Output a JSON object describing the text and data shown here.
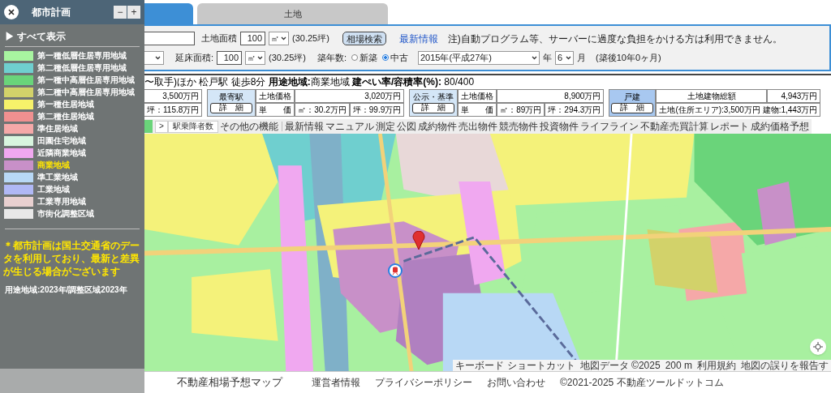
{
  "zoning_panel": {
    "title": "都市計画",
    "minus": "−",
    "plus": "+",
    "show_all": "▶ すべて表示",
    "legend": [
      {
        "label": "第一種低層住居専用地域",
        "color": "#a8f5a0",
        "selected": false
      },
      {
        "label": "第二種低層住居専用地域",
        "color": "#6fcfcf",
        "selected": false
      },
      {
        "label": "第一種中高層住居専用地域",
        "color": "#6ad47a",
        "selected": false
      },
      {
        "label": "第二種中高層住居専用地域",
        "color": "#d2d26a",
        "selected": false
      },
      {
        "label": "第一種住居地域",
        "color": "#f7f26a",
        "selected": false
      },
      {
        "label": "第二種住居地域",
        "color": "#f09090",
        "selected": false
      },
      {
        "label": "準住居地域",
        "color": "#f5a8a8",
        "selected": false
      },
      {
        "label": "田園住宅地域",
        "color": "#d8f5df",
        "selected": false
      },
      {
        "label": "近隣商業地域",
        "color": "#f0a8f0",
        "selected": false
      },
      {
        "label": "商業地域",
        "color": "#c890c8",
        "selected": true
      },
      {
        "label": "準工業地域",
        "color": "#b8d8f5",
        "selected": false
      },
      {
        "label": "工業地域",
        "color": "#b0b8f5",
        "selected": false
      },
      {
        "label": "工業専用地域",
        "color": "#e8d0d0",
        "selected": false
      },
      {
        "label": "市街化調整区域",
        "color": "#e8e8e8",
        "selected": false
      }
    ],
    "note": "＊都市計画は国土交通省のデータを利用しており、最新と差異が生じる場合がございます",
    "data_year": "用途地域:2023年/調整区域2023年"
  },
  "tabs": [
    {
      "selected": true
    },
    {
      "label": "土地",
      "selected": false
    }
  ],
  "search": {
    "land_area_label": "土地面積",
    "land_area": "100",
    "land_unit": "㎡",
    "land_tsubo": "(30.25坪)",
    "search_button": "相場検索",
    "news_link": "最新情報",
    "notice": "注)自動プログラム等、サーバーに過度な負担をかける方は利用できません。",
    "floor_area_label": "延床面積:",
    "floor_area": "100",
    "floor_unit": "㎡",
    "floor_tsubo": "(30.25坪)",
    "age_label": "築年数:",
    "age_options": [
      {
        "label": "新築",
        "selected": false
      },
      {
        "label": "中古",
        "selected": true
      }
    ],
    "year": "2015年(平成27年)",
    "year_unit": "年",
    "month": "6",
    "month_unit": "月",
    "age_text": "(築後10年0ヶ月)"
  },
  "summary": "〜取手)ほか 松戸駅 徒歩8分 **用途地域:**商業地域 **建ぺい率/容積率(%):** 80/400",
  "price_blocks": [
    {
      "kind": "partial",
      "price": "3,500万円",
      "unit": "坪：115.8万円"
    },
    {
      "kind": "price",
      "heading": "最寄駅",
      "detail": "詳　細",
      "label": "土地価格",
      "price": "3,020万円",
      "unit_label": "単　　価",
      "sqm": "㎡：30.2万円",
      "tsubo": "坪：99.9万円"
    },
    {
      "kind": "price",
      "heading": "公示・基準",
      "detail": "詳　細",
      "label": "土地価格",
      "price": "8,900万円",
      "unit_label": "単　　価",
      "sqm": "㎡：89万円",
      "tsubo": "坪：294.3万円"
    },
    {
      "kind": "house",
      "heading": "戸建",
      "detail": "詳　細",
      "label": "土地建物総額",
      "price": "4,943万円",
      "breakdown": "土地(住所エリア):3,500万円 建物:1,443万円"
    }
  ],
  "toolbar": {
    "collapse": ">",
    "station_button": "駅乗降者数",
    "other": "その他の機能",
    "items": [
      "最新情報",
      "マニュアル",
      "測定",
      "公図",
      "成約物件",
      "売出物件",
      "競売物件",
      "投資物件",
      "ライフライン",
      "不動産売買計算",
      "レポート",
      "成約価格予想"
    ]
  },
  "map": {
    "attribution": [
      "キーボード ショートカット",
      "地図データ ©2025",
      "200 m",
      "利用規約",
      "地図の誤りを報告す"
    ]
  },
  "footer": {
    "title": "不動産相場予想マップ",
    "links": [
      "運営者情報",
      "プライバシーポリシー",
      "お問い合わせ"
    ],
    "copyright": "©2021-2025 不動産ツールドットコム"
  }
}
